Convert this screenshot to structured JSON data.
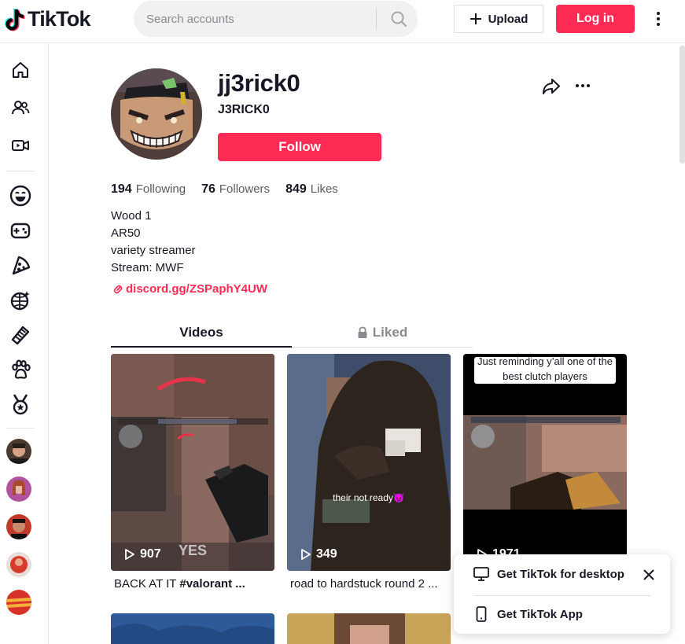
{
  "header": {
    "logo_text": "TikTok",
    "search_placeholder": "Search accounts",
    "upload_label": "Upload",
    "login_label": "Log in"
  },
  "profile": {
    "username": "jj3rick0",
    "nickname": "J3RICK0",
    "follow_label": "Follow",
    "stats": [
      {
        "value": "194",
        "label": "Following"
      },
      {
        "value": "76",
        "label": "Followers"
      },
      {
        "value": "849",
        "label": "Likes"
      }
    ],
    "bio": [
      "Wood 1",
      "AR50",
      "variety streamer",
      "Stream: MWF"
    ],
    "link": "discord.gg/ZSPaphY4UW"
  },
  "tabs": {
    "videos": "Videos",
    "liked": "Liked"
  },
  "videos": [
    {
      "views": "907",
      "caption_text": "BACK AT IT ",
      "caption_tag": "#valorant ...",
      "overlay_text": "YES"
    },
    {
      "views": "349",
      "caption_text": "road to hardstuck round 2 ...",
      "caption_tag": "",
      "overlay_text": "their not ready😈"
    },
    {
      "views": "1971",
      "caption_text": "",
      "caption_tag": "",
      "overlay_text": "Just reminding y’all one of the best clutch players"
    }
  ],
  "popup": {
    "desktop_label": "Get TikTok for desktop",
    "app_label": "Get TikTok App"
  },
  "colors": {
    "accent": "#fe2c55",
    "text": "#161823",
    "muted": "#8a8b91"
  }
}
